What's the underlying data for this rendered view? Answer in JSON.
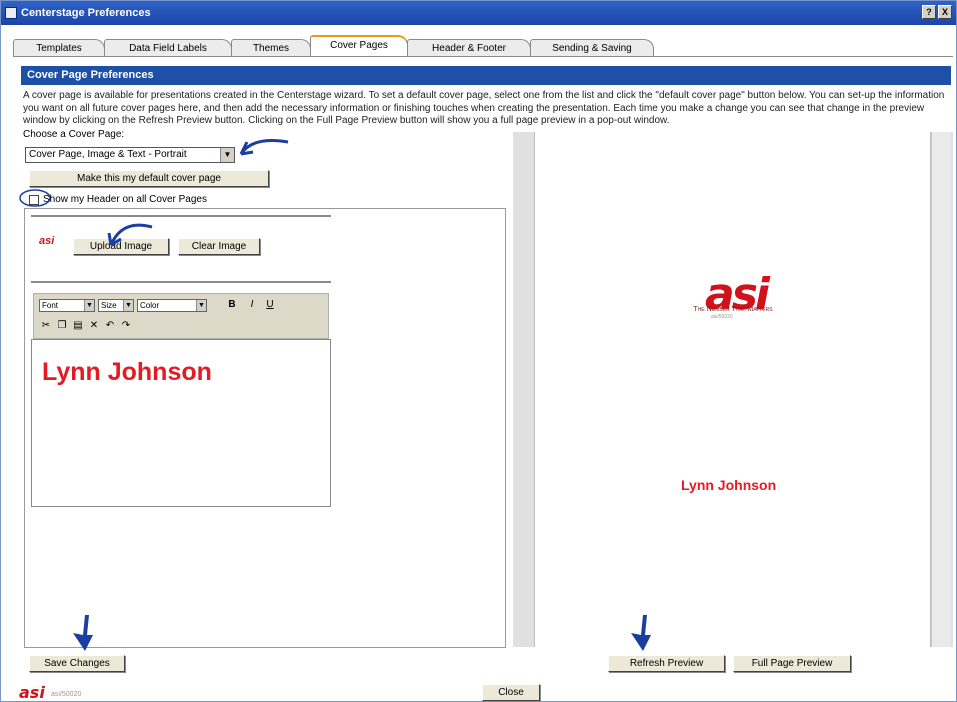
{
  "window": {
    "title": "Centerstage Preferences",
    "controls": [
      "?",
      "X"
    ]
  },
  "tabs": [
    {
      "label": "Templates",
      "active": false
    },
    {
      "label": "Data Field Labels",
      "active": false
    },
    {
      "label": "Themes",
      "active": false
    },
    {
      "label": "Cover Pages",
      "active": true
    },
    {
      "label": "Header & Footer",
      "active": false
    },
    {
      "label": "Sending & Saving",
      "active": false
    }
  ],
  "section": {
    "title": "Cover Page Preferences",
    "intro": "A cover page is available for presentations created in the Centerstage wizard. To set a default cover page, select one from the list and click the \"default cover page\" button below. You can set-up the information you want on all future cover pages here, and then add the necessary information or finishing touches when creating the presentation. Each time you make a change you can see that change in the preview window by clicking on the Refresh Preview button. Clicking on the Full Page Preview button will show you a full page preview in a pop-out window."
  },
  "cover": {
    "choose_label": "Choose a Cover Page:",
    "selected": "Cover Page, Image & Text - Portrait",
    "default_button": "Make this my default cover page",
    "show_header_label": "Show my Header on all Cover Pages",
    "show_header_checked": false
  },
  "image": {
    "logo_text": "asi",
    "upload_button": "Upload Image",
    "clear_button": "Clear Image"
  },
  "editor_toolbar": {
    "font": "Font",
    "size": "Size",
    "color": "Color",
    "bold_icon": "B",
    "italic_icon": "I",
    "underline_icon": "U",
    "icons": [
      "cut-icon",
      "copy-icon",
      "paste-icon",
      "delete-icon",
      "undo-icon",
      "redo-icon"
    ]
  },
  "editor": {
    "text": "Lynn Johnson",
    "text_color": "#e31b23"
  },
  "preview": {
    "logo": "asi",
    "tagline": "The Number That Matters",
    "sub": "asi/50020",
    "name": "Lynn Johnson"
  },
  "buttons": {
    "save": "Save Changes",
    "refresh": "Refresh Preview",
    "full": "Full Page Preview",
    "close": "Close"
  },
  "footer": {
    "logo": "asi",
    "sub": "asi/50020"
  },
  "colors": {
    "accent": "#1e50a8",
    "brand_red": "#d1121b",
    "annotation": "#1a3fa0"
  }
}
